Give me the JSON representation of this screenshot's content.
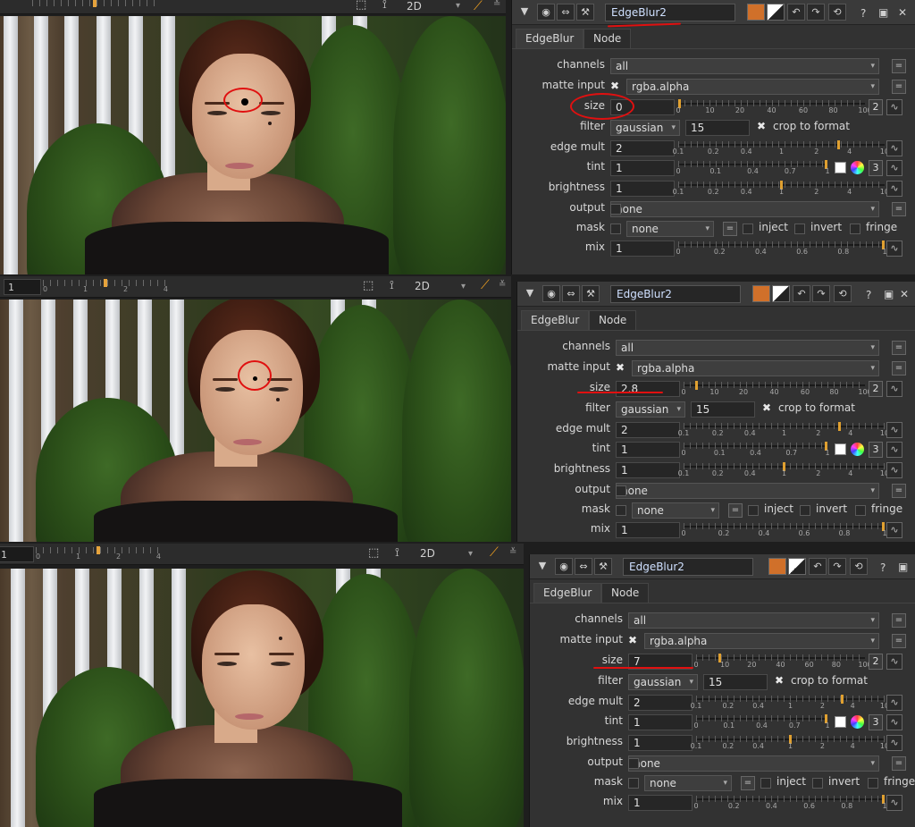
{
  "viewer": {
    "frame_values": [
      "",
      "1",
      "1"
    ],
    "timeline_ticks": [
      "0",
      "1",
      "2",
      "4"
    ],
    "mode": "2D",
    "icons": [
      "roi-icon",
      "transform-handle-icon",
      "dropdown-chevron-icon",
      "color-picker-wand-icon",
      "menu-chevron-icon"
    ]
  },
  "panels": [
    {
      "node_name": "EdgeBlur2",
      "tabs": [
        "EdgeBlur",
        "Node"
      ],
      "knobs": {
        "channels": {
          "label": "channels",
          "value": "all"
        },
        "matte_input": {
          "label": "matte input",
          "value": "rgba.alpha"
        },
        "size": {
          "label": "size",
          "value": "0",
          "count": "2",
          "ticks": [
            "0",
            "10",
            "20",
            "40",
            "60",
            "80",
            "100"
          ]
        },
        "filter": {
          "label": "filter",
          "value": "gaussian",
          "quality": "15",
          "crop_label": "crop to format"
        },
        "edge_mult": {
          "label": "edge mult",
          "value": "2",
          "ticks": [
            "0.1",
            "0.2",
            "0.4",
            "1",
            "2",
            "4",
            "10"
          ]
        },
        "tint": {
          "label": "tint",
          "value": "1",
          "count": "3",
          "ticks": [
            "0",
            "0.1",
            "0.4",
            "0.7",
            "1"
          ]
        },
        "brightness": {
          "label": "brightness",
          "value": "1",
          "ticks": [
            "0.1",
            "0.2",
            "0.4",
            "1",
            "2",
            "4",
            "10"
          ]
        },
        "output": {
          "label": "output",
          "value": "none"
        },
        "mask": {
          "label": "mask",
          "value": "none",
          "inject": "inject",
          "invert": "invert",
          "fringe": "fringe"
        },
        "mix": {
          "label": "mix",
          "value": "1",
          "ticks": [
            "0",
            "0.2",
            "0.4",
            "0.6",
            "0.8",
            "1"
          ]
        }
      }
    },
    {
      "node_name": "EdgeBlur2",
      "tabs": [
        "EdgeBlur",
        "Node"
      ],
      "knobs": {
        "channels": {
          "label": "channels",
          "value": "all"
        },
        "matte_input": {
          "label": "matte input",
          "value": "rgba.alpha"
        },
        "size": {
          "label": "size",
          "value": "2.8",
          "count": "2",
          "ticks": [
            "0",
            "10",
            "20",
            "40",
            "60",
            "80",
            "100"
          ]
        },
        "filter": {
          "label": "filter",
          "value": "gaussian",
          "quality": "15",
          "crop_label": "crop to format"
        },
        "edge_mult": {
          "label": "edge mult",
          "value": "2",
          "ticks": [
            "0.1",
            "0.2",
            "0.4",
            "1",
            "2",
            "4",
            "10"
          ]
        },
        "tint": {
          "label": "tint",
          "value": "1",
          "count": "3",
          "ticks": [
            "0",
            "0.1",
            "0.4",
            "0.7",
            "1"
          ]
        },
        "brightness": {
          "label": "brightness",
          "value": "1",
          "ticks": [
            "0.1",
            "0.2",
            "0.4",
            "1",
            "2",
            "4",
            "10"
          ]
        },
        "output": {
          "label": "output",
          "value": "none"
        },
        "mask": {
          "label": "mask",
          "value": "none",
          "inject": "inject",
          "invert": "invert",
          "fringe": "fringe"
        },
        "mix": {
          "label": "mix",
          "value": "1",
          "ticks": [
            "0",
            "0.2",
            "0.4",
            "0.6",
            "0.8",
            "1"
          ]
        }
      }
    },
    {
      "node_name": "EdgeBlur2",
      "tabs": [
        "EdgeBlur",
        "Node"
      ],
      "knobs": {
        "channels": {
          "label": "channels",
          "value": "all"
        },
        "matte_input": {
          "label": "matte input",
          "value": "rgba.alpha"
        },
        "size": {
          "label": "size",
          "value": "7",
          "count": "2",
          "ticks": [
            "0",
            "10",
            "20",
            "40",
            "60",
            "80",
            "100"
          ]
        },
        "filter": {
          "label": "filter",
          "value": "gaussian",
          "quality": "15",
          "crop_label": "crop to format"
        },
        "edge_mult": {
          "label": "edge mult",
          "value": "2",
          "ticks": [
            "0.1",
            "0.2",
            "0.4",
            "1",
            "2",
            "4",
            "10"
          ]
        },
        "tint": {
          "label": "tint",
          "value": "1",
          "count": "3",
          "ticks": [
            "0",
            "0.1",
            "0.4",
            "0.7",
            "1"
          ]
        },
        "brightness": {
          "label": "brightness",
          "value": "1",
          "ticks": [
            "0.1",
            "0.2",
            "0.4",
            "1",
            "2",
            "4",
            "10"
          ]
        },
        "output": {
          "label": "output",
          "value": "none"
        },
        "mask": {
          "label": "mask",
          "value": "none",
          "inject": "inject",
          "invert": "invert",
          "fringe": "fringe"
        },
        "mix": {
          "label": "mix",
          "value": "1",
          "ticks": [
            "0",
            "0.2",
            "0.4",
            "0.6",
            "0.8",
            "1"
          ]
        }
      }
    }
  ],
  "colors": {
    "annotation_red": "#e01010",
    "slider_handle": "#e0a030",
    "panel_bg": "#323232"
  }
}
